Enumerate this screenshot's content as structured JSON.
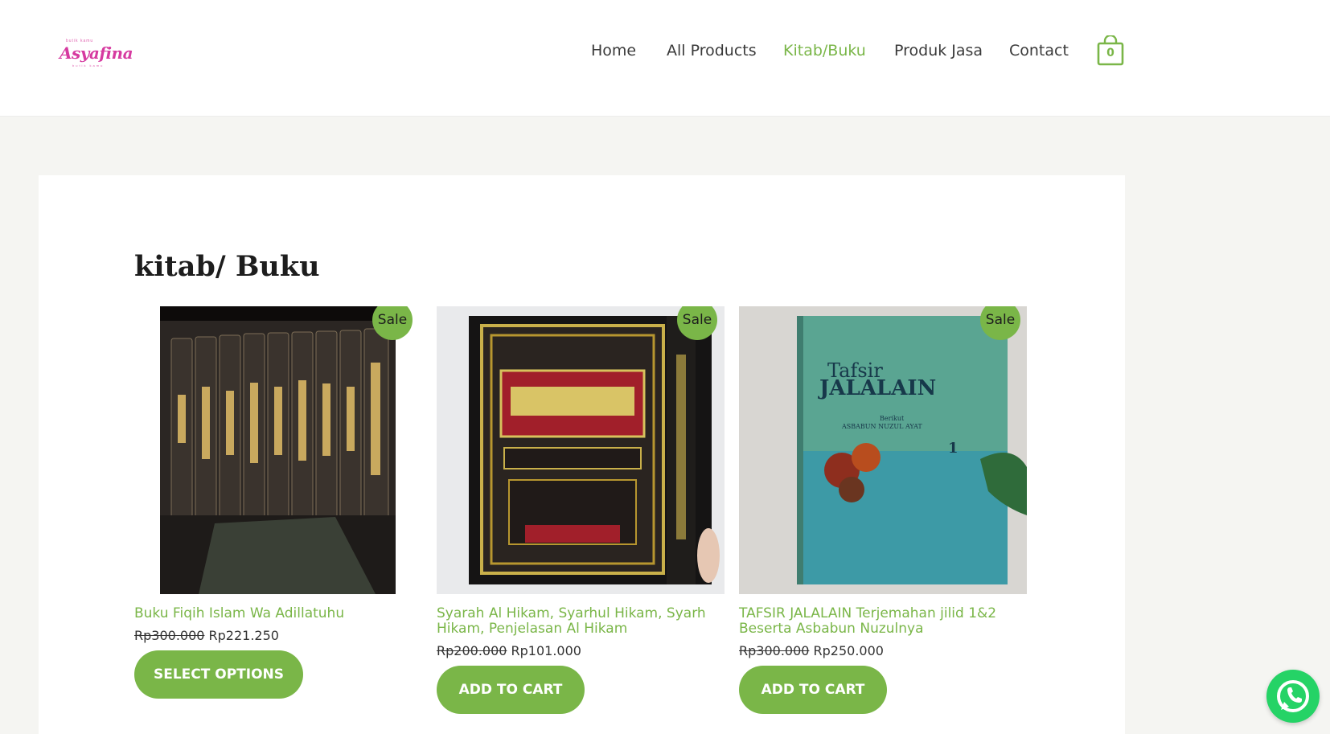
{
  "brand": {
    "logo_top": "butik kamu",
    "logo_text": "Asyafina",
    "logo_sub": "butik kamu"
  },
  "nav": {
    "items": [
      {
        "label": "Home",
        "active": false
      },
      {
        "label": "All Products",
        "active": false
      },
      {
        "label": "Kitab/Buku",
        "active": true
      },
      {
        "label": "Produk Jasa",
        "active": false
      },
      {
        "label": "Contact",
        "active": false
      }
    ],
    "cart_count": "0"
  },
  "page": {
    "title": "kitab/ Buku"
  },
  "products": [
    {
      "title": "Buku Fiqih Islam Wa Adillatuhu",
      "badge": "Sale",
      "old_price": "Rp300.000",
      "new_price": "Rp221.250",
      "button": "SELECT OPTIONS",
      "image": "multi-volume-fiqih-books"
    },
    {
      "title": "Syarah Al Hikam, Syarhul Hikam, Syarh Hikam, Penjelasan Al Hikam",
      "badge": "Sale",
      "old_price": "Rp200.000",
      "new_price": "Rp101.000",
      "button": "ADD TO CART",
      "image": "arabic-ornamented-book-cover"
    },
    {
      "title": "TAFSIR JALALAIN Terjemahan jilid 1&2 Beserta Asbabun Nuzulnya",
      "badge": "Sale",
      "old_price": "Rp300.000",
      "new_price": "Rp250.000",
      "button": "ADD TO CART",
      "image": "tafsir-jalalain-teal-book",
      "cover_text": {
        "line1": "Tafsir",
        "line2": "JALALAIN",
        "line3": "Berikut",
        "line4": "ASBABUN NUZUL AYAT",
        "volume": "1"
      }
    }
  ],
  "colors": {
    "accent": "#7ab648",
    "logo": "#d63aa0",
    "whatsapp": "#25d366"
  },
  "icons": {
    "cart": "shopping-bag-icon",
    "whatsapp": "whatsapp-icon"
  }
}
